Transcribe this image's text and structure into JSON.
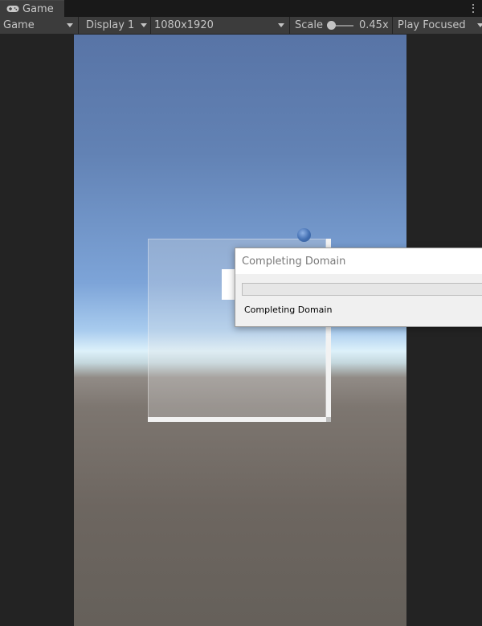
{
  "tab": {
    "title": "Game",
    "icon": "gamepad-icon"
  },
  "toolbar": {
    "view_mode": "Game",
    "display": "Display 1",
    "resolution": "1080x1920",
    "scale_label": "Scale",
    "scale_value": "0.45x",
    "scale_fraction": 0.45,
    "play_mode": "Play Focused"
  },
  "dialog": {
    "title": "Completing Domain",
    "info": "Completing Domain",
    "progress": 0
  },
  "colors": {
    "editor_bg": "#232323",
    "toolbar_bg": "#3c3c3c",
    "sky_top": "#5874a6",
    "horizon": "#ddf1fa",
    "ground": "#6d6660"
  }
}
